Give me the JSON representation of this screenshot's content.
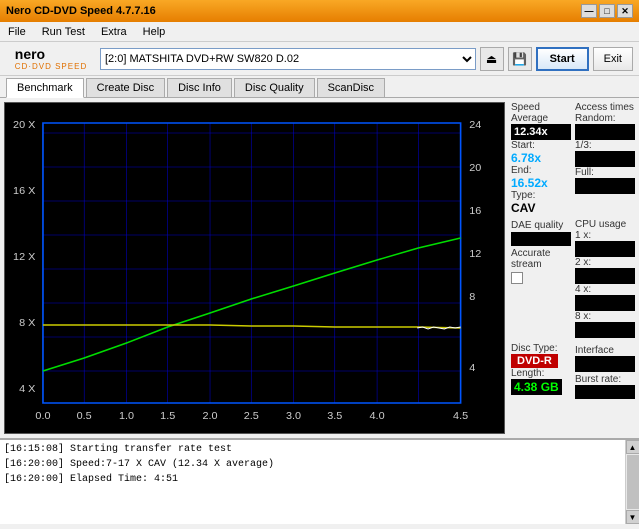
{
  "titleBar": {
    "title": "Nero CD-DVD Speed 4.7.7.16",
    "minimize": "—",
    "maximize": "□",
    "close": "✕"
  },
  "menuBar": {
    "items": [
      "File",
      "Run Test",
      "Extra",
      "Help"
    ]
  },
  "toolbar": {
    "logoNero": "nero",
    "logoSub": "CD·DVD SPEED",
    "driveLabel": "[2:0]  MATSHITA DVD+RW SW820 D.02",
    "startLabel": "Start",
    "exitLabel": "Exit"
  },
  "tabs": [
    {
      "label": "Benchmark",
      "active": true
    },
    {
      "label": "Create Disc",
      "active": false
    },
    {
      "label": "Disc Info",
      "active": false
    },
    {
      "label": "Disc Quality",
      "active": false
    },
    {
      "label": "ScanDisc",
      "active": false
    }
  ],
  "rightPanel": {
    "speed": {
      "sectionLabel": "Speed",
      "averageLabel": "Average",
      "averageValue": "12.34x",
      "startLabel": "Start:",
      "startValue": "6.78x",
      "endLabel": "End:",
      "endValue": "16.52x",
      "typeLabel": "Type:",
      "typeValue": "CAV"
    },
    "accessTimes": {
      "sectionLabel": "Access times",
      "randomLabel": "Random:",
      "oneThirdLabel": "1/3:",
      "fullLabel": "Full:"
    },
    "dae": {
      "sectionLabel": "DAE quality",
      "accurateLabel": "Accurate",
      "streamLabel": "stream"
    },
    "cpu": {
      "sectionLabel": "CPU usage",
      "1x": "1 x:",
      "2x": "2 x:",
      "4x": "4 x:",
      "8x": "8 x:"
    },
    "disc": {
      "typeLabel": "Disc",
      "typeSub": "Type:",
      "typeValue": "DVD-R",
      "lengthLabel": "Length:",
      "lengthValue": "4.38 GB"
    },
    "interface": {
      "label": "Interface"
    },
    "burst": {
      "label": "Burst rate:"
    }
  },
  "chartYAxisLeft": [
    "20 X",
    "16 X",
    "12 X",
    "8 X",
    "4 X"
  ],
  "chartYAxisRight": [
    "24",
    "20",
    "16",
    "12",
    "8",
    "4"
  ],
  "chartXAxis": [
    "0.0",
    "0.5",
    "1.0",
    "1.5",
    "2.0",
    "2.5",
    "3.0",
    "3.5",
    "4.0",
    "4.5"
  ],
  "log": {
    "lines": [
      "[16:15:08]  Starting transfer rate test",
      "[16:20:00]  Speed:7-17 X CAV (12.34 X average)",
      "[16:20:00]  Elapsed Time: 4:51"
    ]
  }
}
